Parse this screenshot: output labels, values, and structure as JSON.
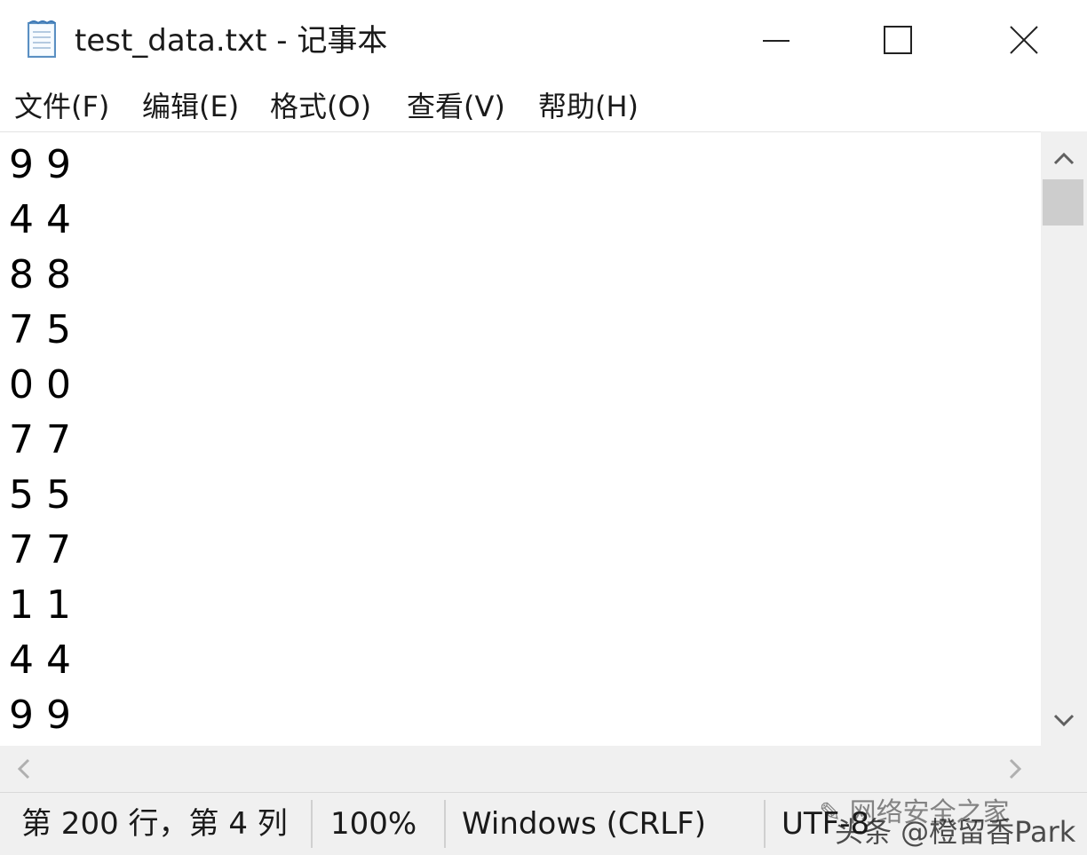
{
  "window": {
    "title": "test_data.txt - 记事本",
    "icons": {
      "app": "notepad-icon",
      "minimize": "minimize-icon",
      "maximize": "maximize-icon",
      "close": "close-icon"
    }
  },
  "menubar": {
    "items": [
      {
        "label": "文件(F)"
      },
      {
        "label": "编辑(E)"
      },
      {
        "label": "格式(O)"
      },
      {
        "label": "查看(V)"
      },
      {
        "label": "帮助(H)"
      }
    ]
  },
  "editor": {
    "lines": [
      "9 9",
      "4 4",
      "8 8",
      "7 5",
      "0 0",
      "7 7",
      "5 5",
      "7 7",
      "1 1",
      "4 4",
      "9 9"
    ]
  },
  "statusbar": {
    "position": "第 200 行，第 4 列",
    "zoom": "100%",
    "line_ending": "Windows (CRLF)",
    "encoding": "UTF-8"
  },
  "watermark": {
    "line1": "✎ 网络安全之家",
    "line2": "头条 @橙留香Park"
  }
}
